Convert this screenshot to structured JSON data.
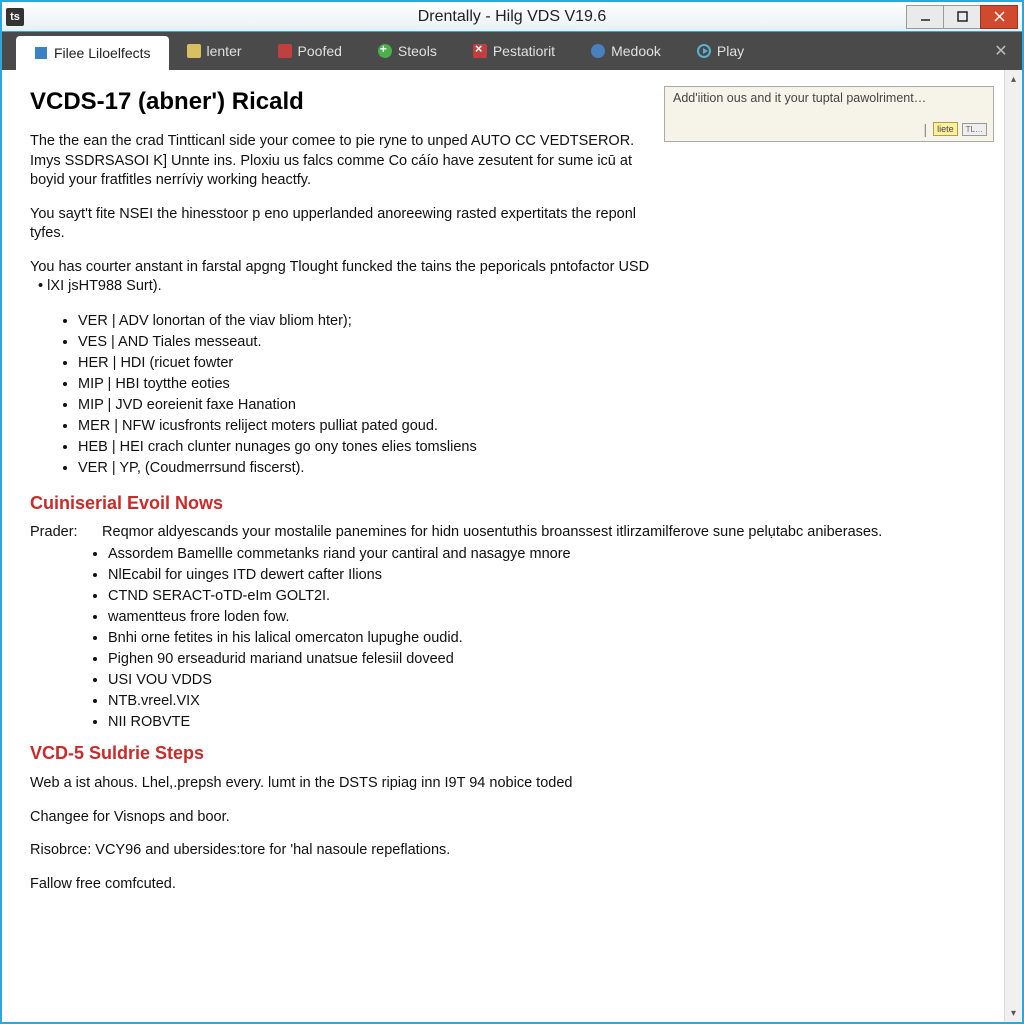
{
  "titlebar": {
    "icon_text": "ts",
    "title": "Drentally - Hilg VDS V19.6"
  },
  "toolbar": {
    "tabs": [
      {
        "label": "Filee Liloelfects"
      },
      {
        "label": "lenter"
      },
      {
        "label": "Poofed"
      },
      {
        "label": "Steols"
      },
      {
        "label": "Pestatiorit"
      },
      {
        "label": "Medook"
      },
      {
        "label": "Play"
      }
    ]
  },
  "sidebox": {
    "text": "Add'iition ous and it your tuptal pawolriment…",
    "btn1": "liete",
    "btn2": "TL…"
  },
  "main": {
    "h1": "VCDS-17 (abner') Ricald",
    "p1": "The the ean the crad Tintticanl side your comee to pie ryne to unped AUTO CC VEDTSEROR. Imys SSDRSASOI K]   Unnte ins. Ploxiu us falcs comme Co cáío have zesutent for sume icū at boyid your fratfitles nerríviy working heactfy.",
    "p2": "You sayt't fite NSEI the hinesstoor p eno upperlanded anoreewing rasted expertitats the reponl tyfes.",
    "p3a": "You has courter anstant in farstal apgng Tlought funcked the tains the peporicals pntofactor USD",
    "p3b": "lXI jsHT988 Surt).",
    "list1": [
      "VER | ADV lonortan of the viav bliom hter);",
      "VES | AND Tiales messeaut.",
      "HER | HDI (ricuet fowter",
      "MIP | HBI toytthe eoties",
      "MIP | JVD eoreienit faxe Hanation",
      "MER | NFW icusfronts reliject moters pulliat pated goud.",
      "HEB | HEI crach clunter nunages go ony tones elies tomsliens",
      "VER | YP, (Coudmerrsund fiscerst)."
    ],
    "h2a": "Cuiniserial Evoil Nows",
    "prader_label": "Prader:",
    "prader_text": "Reqmor aldyescands your mostalile panemines for hidn uosentuthis broanssest itlirzamilferove sune pelụtabc aniberases.",
    "list2": [
      "Assordem Bamellle commetanks riand your cantiral and nasagye mnore",
      "NlEcabil for uinges ITD dewert cafter Ilions",
      "CTND SERACT-oTD-eIm GOLT2I.",
      "wamentteus frore loden fow.",
      "Bnhi orne fetites in his lalical omercaton lupughe oudid.",
      "Pighen 90 erseadurid mariand unatsue felesiil doveed",
      "USI VOU VDDS",
      "NTB.vreel.VIX",
      "NII ROBVTE"
    ],
    "h2b": "VCD-5 Suldrie Steps",
    "p4": "Web a ist ahous. Lhel,.prepsh every. lumt in the DSTS ripiag inn I9T 94 nobice toded",
    "p5": "Changee for Visnops and boor.",
    "p6": "Risobrce: VCY96 and ubersides:tore for 'hal nasoule repeflations.",
    "p7": "Fallow free comfcuted."
  }
}
